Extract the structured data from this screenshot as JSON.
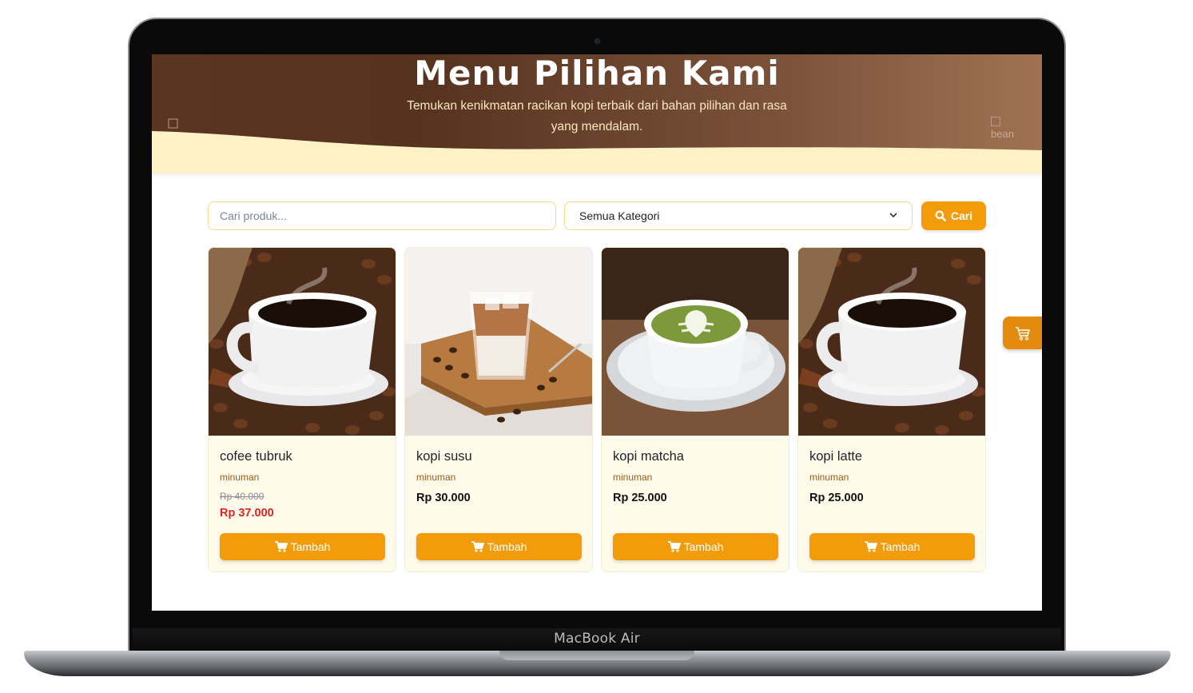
{
  "device": {
    "label": "MacBook Air"
  },
  "hero": {
    "title": "Menu Pilihan Kami",
    "subtitle": "Temukan kenikmatan racikan kopi terbaik dari bahan pilihan dan rasa yang mendalam.",
    "bean_alt": "bean"
  },
  "search": {
    "placeholder": "Cari produk...",
    "category_selected": "Semua Kategori",
    "button_label": "Cari"
  },
  "products": [
    {
      "name": "cofee tubruk",
      "category": "minuman",
      "price_original": "Rp 40.000",
      "price": "Rp 37.000",
      "on_sale": true,
      "button": "Tambah",
      "image": "black-coffee-cup"
    },
    {
      "name": "kopi susu",
      "category": "minuman",
      "price": "Rp 30.000",
      "on_sale": false,
      "button": "Tambah",
      "image": "iced-coffee-glass"
    },
    {
      "name": "kopi matcha",
      "category": "minuman",
      "price": "Rp 25.000",
      "on_sale": false,
      "button": "Tambah",
      "image": "matcha-latte-cup"
    },
    {
      "name": "kopi latte",
      "category": "minuman",
      "price": "Rp 25.000",
      "on_sale": false,
      "button": "Tambah",
      "image": "black-coffee-cup"
    }
  ],
  "colors": {
    "accent": "#f39c0b",
    "hero_dark": "#56331f",
    "hero_light": "#a07253",
    "wave": "#fdf1c6",
    "sale_price": "#dc2626",
    "card_bg": "#fffbea"
  },
  "floating_cart": {
    "icon": "cart-icon"
  }
}
